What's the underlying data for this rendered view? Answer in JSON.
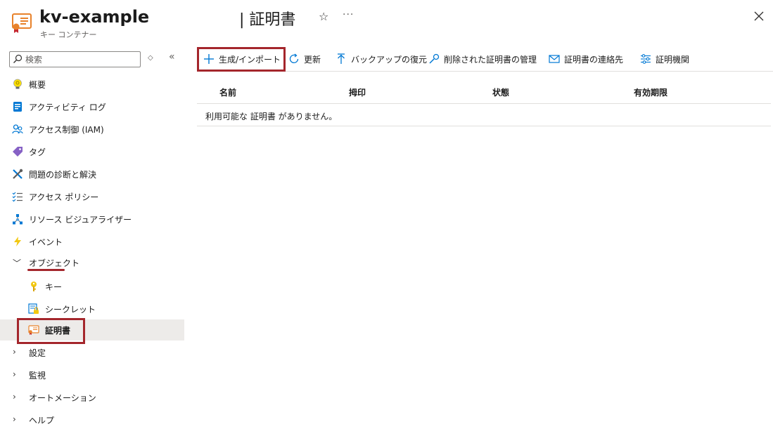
{
  "header": {
    "resource_name": "kv-example",
    "resource_type": "キー コンテナー",
    "page_title": "| 証明書",
    "favorite_icon": "star-icon",
    "more_icon": "ellipsis-icon",
    "close_icon": "close-icon"
  },
  "sidebar": {
    "search_placeholder": "検索",
    "sort_icon": "◇",
    "collapse_icon": "«",
    "items": [
      {
        "label": "概要",
        "icon": "lightbulb-icon"
      },
      {
        "label": "アクティビティ ログ",
        "icon": "activity-log-icon"
      },
      {
        "label": "アクセス制御 (IAM)",
        "icon": "people-icon"
      },
      {
        "label": "タグ",
        "icon": "tag-icon"
      },
      {
        "label": "問題の診断と解決",
        "icon": "wrench-icon"
      },
      {
        "label": "アクセス ポリシー",
        "icon": "checklist-icon"
      },
      {
        "label": "リソース ビジュアライザー",
        "icon": "visualizer-icon"
      },
      {
        "label": "イベント",
        "icon": "lightning-icon"
      },
      {
        "label": "オブジェクト",
        "icon": "chevron-down-icon"
      },
      {
        "label": "キー",
        "icon": "key-icon"
      },
      {
        "label": "シークレット",
        "icon": "secret-icon"
      },
      {
        "label": "証明書",
        "icon": "certificate-icon"
      },
      {
        "label": "設定",
        "icon": "chevron-right-icon"
      },
      {
        "label": "監視",
        "icon": "chevron-right-icon"
      },
      {
        "label": "オートメーション",
        "icon": "chevron-right-icon"
      },
      {
        "label": "ヘルプ",
        "icon": "chevron-right-icon"
      }
    ]
  },
  "toolbar": {
    "generate_import": "生成/インポート",
    "refresh": "更新",
    "restore_backup": "バックアップの復元",
    "manage_deleted": "削除された証明書の管理",
    "contacts": "証明書の連絡先",
    "authorities": "証明機関"
  },
  "table": {
    "columns": [
      "名前",
      "拇印",
      "状態",
      "有効期限"
    ],
    "empty_message": "利用可能な 証明書 がありません。"
  },
  "colors": {
    "highlight": "#a4262c",
    "accent": "#0078d4",
    "selected_bg": "#edebe9"
  }
}
